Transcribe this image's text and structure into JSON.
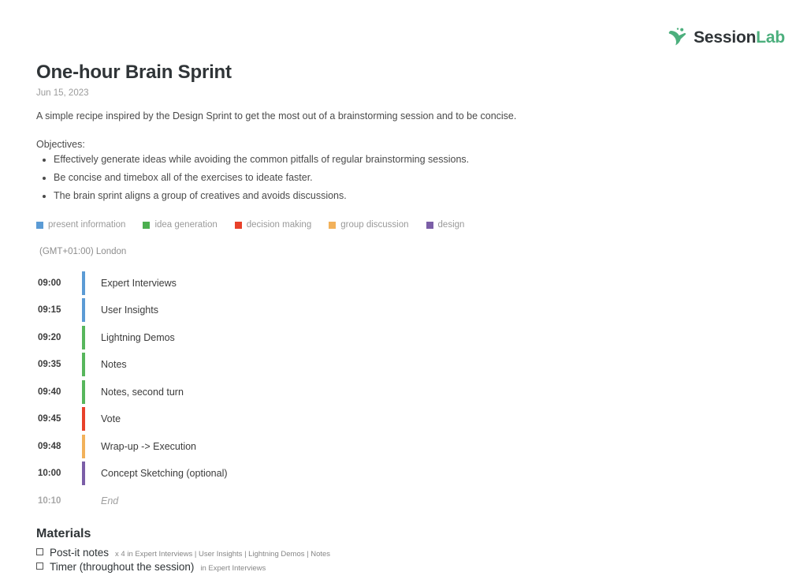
{
  "brand": {
    "name_part1": "Session",
    "name_part2": "Lab",
    "mark_color": "#4caf7d",
    "text_color": "#2f3437"
  },
  "header": {
    "title": "One-hour Brain Sprint",
    "date": "Jun 15, 2023",
    "description": "A simple recipe inspired by the Design Sprint to get the most out of a brainstorming session and to be concise.",
    "objectives_label": "Objectives:",
    "objectives": [
      "Effectively generate ideas while avoiding the common pitfalls of regular brainstorming sessions.",
      "Be concise and timebox all of the exercises to ideate faster.",
      "The brain sprint aligns a group of creatives and avoids discussions."
    ]
  },
  "legend": [
    {
      "label": "present information",
      "color": "#5b9bd5"
    },
    {
      "label": "idea generation",
      "color": "#4caf50"
    },
    {
      "label": "decision making",
      "color": "#e8412a"
    },
    {
      "label": "group discussion",
      "color": "#f2b15a"
    },
    {
      "label": "design",
      "color": "#7b5ea7"
    }
  ],
  "timezone": "(GMT+01:00) London",
  "schedule": [
    {
      "time": "09:00",
      "name": "Expert Interviews",
      "color": "#5b9bd5",
      "is_end": false
    },
    {
      "time": "09:15",
      "name": "User Insights",
      "color": "#5b9bd5",
      "is_end": false
    },
    {
      "time": "09:20",
      "name": "Lightning Demos",
      "color": "#57b65c",
      "is_end": false
    },
    {
      "time": "09:35",
      "name": "Notes",
      "color": "#57b65c",
      "is_end": false
    },
    {
      "time": "09:40",
      "name": "Notes, second turn",
      "color": "#57b65c",
      "is_end": false
    },
    {
      "time": "09:45",
      "name": "Vote",
      "color": "#e8412a",
      "is_end": false
    },
    {
      "time": "09:48",
      "name": "Wrap-up -> Execution",
      "color": "#f2b15a",
      "is_end": false
    },
    {
      "time": "10:00",
      "name": "Concept Sketching (optional)",
      "color": "#7b5ea7",
      "is_end": false
    },
    {
      "time": "10:10",
      "name": "End",
      "color": "transparent",
      "is_end": true
    }
  ],
  "materials": {
    "title": "Materials",
    "items": [
      {
        "name": "Post-it notes",
        "meta": "x 4 in Expert Interviews | User Insights | Lightning Demos | Notes"
      },
      {
        "name": "Timer (throughout the session)",
        "meta": "in Expert Interviews"
      }
    ]
  }
}
